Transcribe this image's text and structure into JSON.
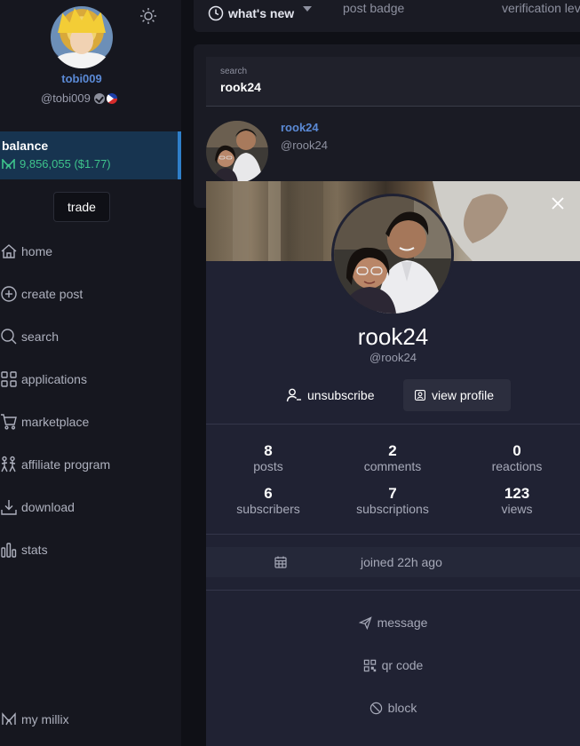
{
  "sidebar": {
    "profile": {
      "name": "tobi009",
      "handle": "@tobi009"
    },
    "balance": {
      "title": "balance",
      "amount": "9,856,055 ($1.77)"
    },
    "trade_label": "trade",
    "nav": [
      {
        "label": "home",
        "icon": "home-icon"
      },
      {
        "label": "create post",
        "icon": "plus-circle-icon"
      },
      {
        "label": "search",
        "icon": "search-icon"
      },
      {
        "label": "applications",
        "icon": "grid-icon"
      },
      {
        "label": "marketplace",
        "icon": "cart-icon"
      },
      {
        "label": "affiliate program",
        "icon": "people-icon"
      },
      {
        "label": "download",
        "icon": "download-icon"
      },
      {
        "label": "stats",
        "icon": "bar-chart-icon"
      }
    ],
    "footer_label": "my millix"
  },
  "topbar": {
    "tabs": [
      "what's new",
      "post badge",
      "verification lev"
    ]
  },
  "search": {
    "label": "search",
    "value": "rook24",
    "result": {
      "name": "rook24",
      "handle": "@rook24"
    }
  },
  "popup": {
    "username": "rook24",
    "handle": "@rook24",
    "unsubscribe_label": "unsubscribe",
    "view_profile_label": "view profile",
    "stats": [
      {
        "value": "8",
        "label": "posts"
      },
      {
        "value": "2",
        "label": "comments"
      },
      {
        "value": "0",
        "label": "reactions"
      },
      {
        "value": "6",
        "label": "subscribers"
      },
      {
        "value": "7",
        "label": "subscriptions"
      },
      {
        "value": "123",
        "label": "views"
      }
    ],
    "joined": "joined 22h ago",
    "message_label": "message",
    "qr_label": "qr code",
    "block_label": "block"
  },
  "colors": {
    "accent_blue": "#5b8ad6",
    "balance_green": "#3ec48c",
    "balance_bg": "#173450"
  }
}
